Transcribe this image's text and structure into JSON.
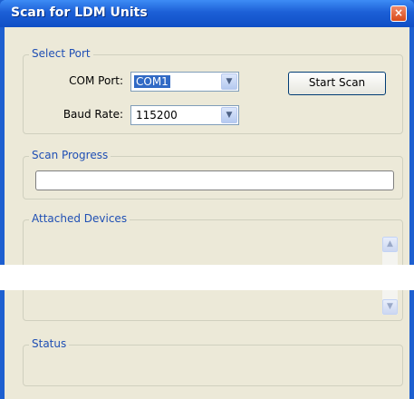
{
  "window": {
    "title": "Scan for LDM Units",
    "close_symbol": "×"
  },
  "select_port": {
    "legend": "Select Port",
    "com_port_label": "COM Port:",
    "com_port_value": "COM1",
    "baud_rate_label": "Baud Rate:",
    "baud_rate_value": "115200",
    "start_scan_label": "Start Scan"
  },
  "scan_progress": {
    "legend": "Scan Progress",
    "progress_fraction": 0
  },
  "attached_devices": {
    "legend": "Attached Devices",
    "scroll_up_symbol": "▲",
    "scroll_down_symbol": "▼"
  },
  "status": {
    "legend": "Status"
  },
  "icons": {
    "dropdown_arrow": "▼"
  }
}
